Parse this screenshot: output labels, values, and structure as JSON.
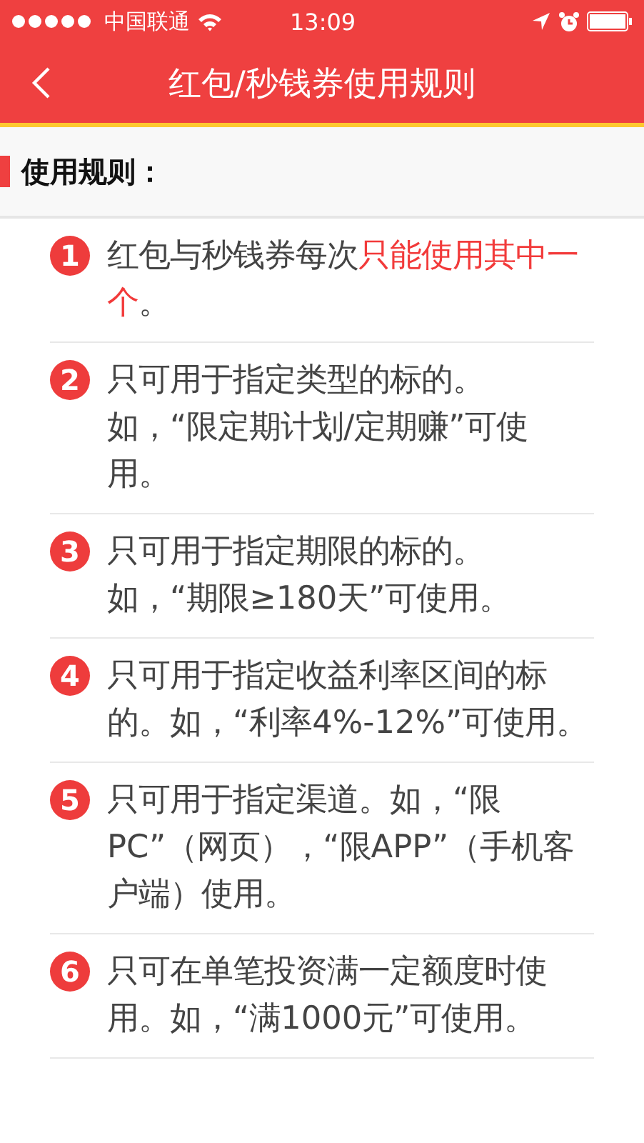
{
  "status_bar": {
    "carrier": "中国联通",
    "time": "13:09"
  },
  "nav": {
    "title": "红包/秒钱券使用规则"
  },
  "section": {
    "title": "使用规则："
  },
  "rules": [
    {
      "number": "1",
      "segments": [
        {
          "text": "红包与秒钱券每次",
          "highlight": false
        },
        {
          "text": "只能使用其中一个",
          "highlight": true
        },
        {
          "text": "。",
          "highlight": false
        }
      ]
    },
    {
      "number": "2",
      "segments": [
        {
          "text": "只可用于指定类型的标的。",
          "highlight": false
        },
        {
          "text": "如，“限定期计划/定期赚”可使用。",
          "highlight": false,
          "new_line": true
        }
      ]
    },
    {
      "number": "3",
      "segments": [
        {
          "text": "只可用于指定期限的标的。",
          "highlight": false
        },
        {
          "text": "如，“期限≥180天”可使用。",
          "highlight": false,
          "new_line": true
        }
      ]
    },
    {
      "number": "4",
      "segments": [
        {
          "text": "只可用于指定收益利率区间的标的。如，“利率4%-12%”可使用。",
          "highlight": false
        }
      ]
    },
    {
      "number": "5",
      "segments": [
        {
          "text": "只可用于指定渠道。如，“限PC”（网页），“限APP”（手机客户端）使用。",
          "highlight": false
        }
      ]
    },
    {
      "number": "6",
      "segments": [
        {
          "text": "只可在单笔投资满一定额度时使用。如，“满1000元”可使用。",
          "highlight": false
        }
      ]
    }
  ]
}
